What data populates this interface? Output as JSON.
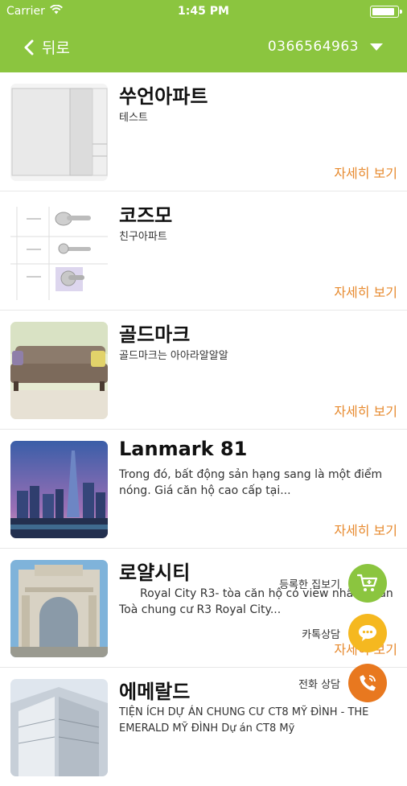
{
  "status_bar": {
    "carrier": "Carrier",
    "time": "1:45 PM",
    "battery_level": 1.0
  },
  "nav": {
    "back_label": "뒤로",
    "phone_selected": "0366564963"
  },
  "items": [
    {
      "title": "쑤언아파트",
      "subtitle": "테스트",
      "detail_label": "자세히 보기",
      "thumb_icon": "cabinet-image"
    },
    {
      "title": "코즈모",
      "subtitle": "친구아파트",
      "detail_label": "자세히 보기",
      "thumb_icon": "door-handle-sheet-image"
    },
    {
      "title": "골드마크",
      "subtitle": "골드마크는 아아라알알알",
      "detail_label": "자세히 보기",
      "thumb_icon": "sofa-image"
    },
    {
      "title": "Lanmark 81",
      "subtitle": "Trong đó, bất động sản hạng sang là một điểm nóng. Giá căn hộ cao cấp tại...",
      "detail_label": "자세히 보기",
      "thumb_icon": "skyline-image"
    },
    {
      "title": "로얄시티",
      "subtitle": "Royal City R3- tòa căn hộ có view nhất dự án Toà chung cư R3 Royal City...",
      "detail_label": "자세히 보기",
      "thumb_icon": "royal-city-building-image"
    },
    {
      "title": "에메랄드",
      "subtitle": "TIỆN ÍCH DỰ ÁN CHUNG CƯ CT8 MỸ ĐÌNH - THE EMERALD MỸ ĐÌNH Dự án CT8 Mỹ",
      "detail_label": "",
      "thumb_icon": "emerald-building-image"
    }
  ],
  "fabs": [
    {
      "label": "등록한 집보기",
      "icon": "cart-icon",
      "color": "#8bc53f"
    },
    {
      "label": "카톡상담",
      "icon": "chat-icon",
      "color": "#f5b820"
    },
    {
      "label": "전화 상담",
      "icon": "phone-icon",
      "color": "#e8781f"
    }
  ],
  "colors": {
    "header_green": "#8bc53f",
    "detail_orange": "#e78a2e"
  }
}
